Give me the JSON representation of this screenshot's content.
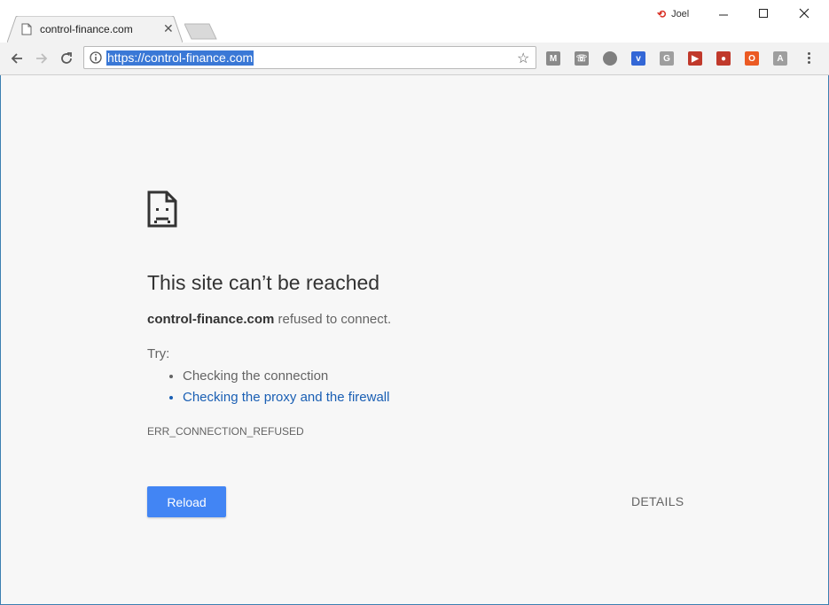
{
  "tab": {
    "title": "control-finance.com"
  },
  "profile": {
    "name": "Joel"
  },
  "omnibox": {
    "url": "https://control-finance.com"
  },
  "extensions": [
    {
      "name": "gmail-icon",
      "color": "#8a8a8a",
      "glyph": "M"
    },
    {
      "name": "chat-icon",
      "color": "#8a8a8a",
      "glyph": "☏"
    },
    {
      "name": "speech-bubble-icon",
      "color": "#7f7f7f",
      "glyph": ""
    },
    {
      "name": "v-icon",
      "color": "#3367d6",
      "glyph": "v"
    },
    {
      "name": "g-icon",
      "color": "#9e9e9e",
      "glyph": "G"
    },
    {
      "name": "film-icon",
      "color": "#c0392b",
      "glyph": "▶"
    },
    {
      "name": "map-pin-icon",
      "color": "#c0392b",
      "glyph": "●"
    },
    {
      "name": "office-icon",
      "color": "#eb5a23",
      "glyph": "O"
    },
    {
      "name": "pdf-icon",
      "color": "#9e9e9e",
      "glyph": "A"
    }
  ],
  "error": {
    "heading": "This site can’t be reached",
    "host": "control-finance.com",
    "refused_text": " refused to connect.",
    "try_label": "Try:",
    "suggestions": [
      "Checking the connection",
      "Checking the proxy and the firewall"
    ],
    "code": "ERR_CONNECTION_REFUSED",
    "reload_label": "Reload",
    "details_label": "DETAILS"
  },
  "colors": {
    "accent": "#4285f4",
    "link": "#1a5fb4",
    "selection": "#3a78d6"
  }
}
